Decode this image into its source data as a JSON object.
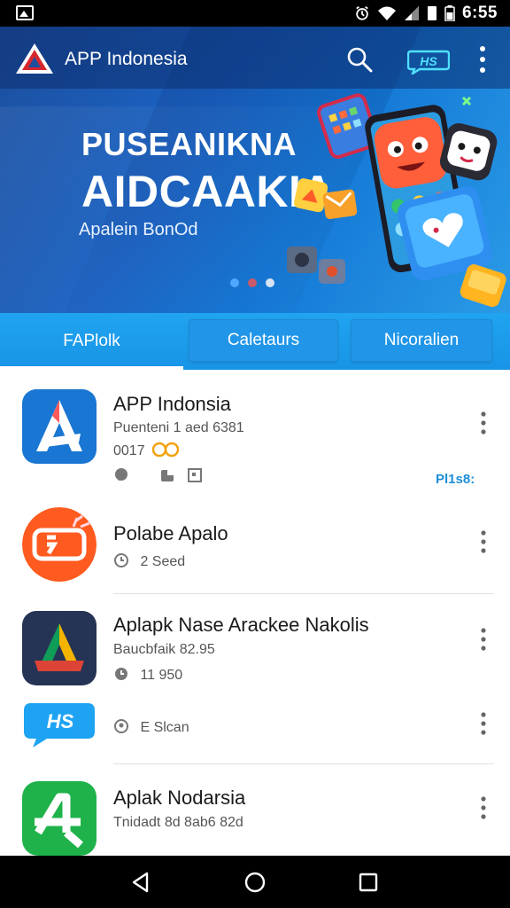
{
  "status_bar": {
    "time": "6:55"
  },
  "header": {
    "app_title": "APP Indonesia",
    "search_icon": "search-icon",
    "hs_icon": "hs-badge-icon",
    "more_icon": "more-vert-icon"
  },
  "hero": {
    "line1": "PUSEANIKNA",
    "line2": "AIDCAAKIA",
    "subtitle": "Apalein BonOd",
    "carousel_pages": 3,
    "active_page": 0
  },
  "tabs": [
    {
      "label": "FAPlolk",
      "active": true
    },
    {
      "label": "Caletaurs",
      "active": false
    },
    {
      "label": "Nicoralien",
      "active": false
    }
  ],
  "list": [
    {
      "name": "APP Indonsia",
      "meta1": "Puenteni 1 aed 6381",
      "meta2": "0017",
      "price": "Pl1s8:",
      "icon": "app-indonesia-a-icon"
    },
    {
      "name": "Polabe Apalo",
      "meta1": "2 Seed",
      "icon": "polabe-apalo-icon"
    },
    {
      "name": "Aplapk Nase Arackee Nakolis",
      "meta1": "Baucbfaik 82.95",
      "meta2": "11 950",
      "icon": "aplapk-a-icon"
    },
    {
      "name": "",
      "meta1": "E Slcan",
      "icon": "hs-chat-icon"
    },
    {
      "name": "Aplak Nodarsia",
      "meta1": "Tnidadt 8d 8ab6 82d",
      "icon": "aplak-nodarsia-icon"
    }
  ],
  "colors": {
    "accent": "#1894e6",
    "header_dark": "#1d4f9e",
    "price_blue": "#1c8fd8"
  }
}
